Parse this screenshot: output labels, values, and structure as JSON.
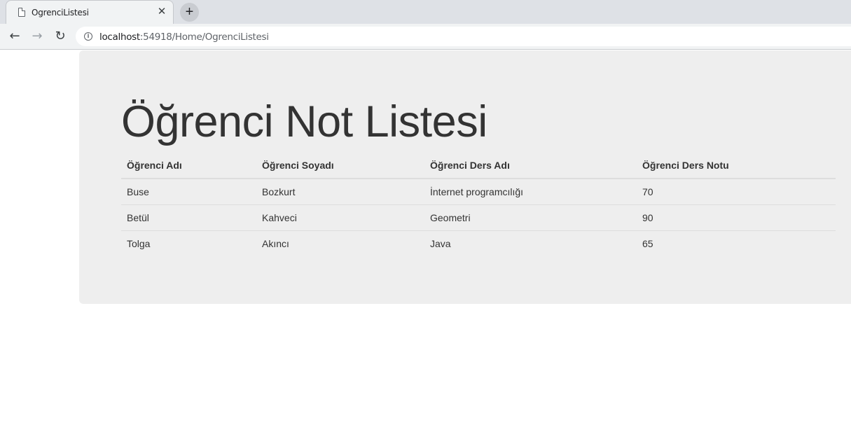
{
  "browser": {
    "tab_title": "OgrenciListesi",
    "tab_close": "✕",
    "new_tab": "+",
    "url_host": "localhost",
    "url_path": ":54918/Home/OgrenciListesi",
    "nav": {
      "back": "←",
      "forward": "→",
      "reload": "↻",
      "info": "i"
    }
  },
  "page": {
    "title": "Öğrenci Not Listesi",
    "table": {
      "headers": [
        "Öğrenci Adı",
        "Öğrenci Soyadı",
        "Öğrenci Ders Adı",
        "Öğrenci Ders Notu"
      ],
      "rows": [
        [
          "Buse",
          "Bozkurt",
          "İnternet programcılığı",
          "70"
        ],
        [
          "Betül",
          "Kahveci",
          "Geometri",
          "90"
        ],
        [
          "Tolga",
          "Akıncı",
          "Java",
          "65"
        ]
      ]
    }
  }
}
